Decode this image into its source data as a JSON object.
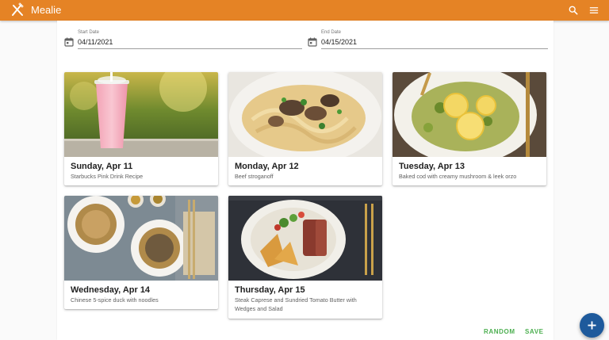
{
  "app": {
    "title": "Mealie"
  },
  "header": {
    "search_icon": "search-icon",
    "menu_icon": "menu-icon"
  },
  "date_range": {
    "start": {
      "label": "Start Date",
      "value": "04/11/2021"
    },
    "end": {
      "label": "End Date",
      "value": "04/15/2021"
    }
  },
  "meals": [
    {
      "day": "Sunday, Apr 11",
      "recipe": "Starbucks Pink Drink Recipe"
    },
    {
      "day": "Monday, Apr 12",
      "recipe": "Beef stroganoff"
    },
    {
      "day": "Tuesday, Apr 13",
      "recipe": "Baked cod with creamy mushroom & leek orzo"
    },
    {
      "day": "Wednesday, Apr 14",
      "recipe": "Chinese 5-spice duck with noodles"
    },
    {
      "day": "Thursday, Apr 15",
      "recipe": "Steak Caprese and Sundried Tomato Butter with Wedges and Salad"
    }
  ],
  "actions": {
    "random_label": "RANDOM",
    "save_label": "SAVE",
    "add_icon": "plus-icon"
  },
  "colors": {
    "app_bar": "#e58325",
    "action_text": "#4caf50",
    "fab": "#1e5a9c"
  }
}
